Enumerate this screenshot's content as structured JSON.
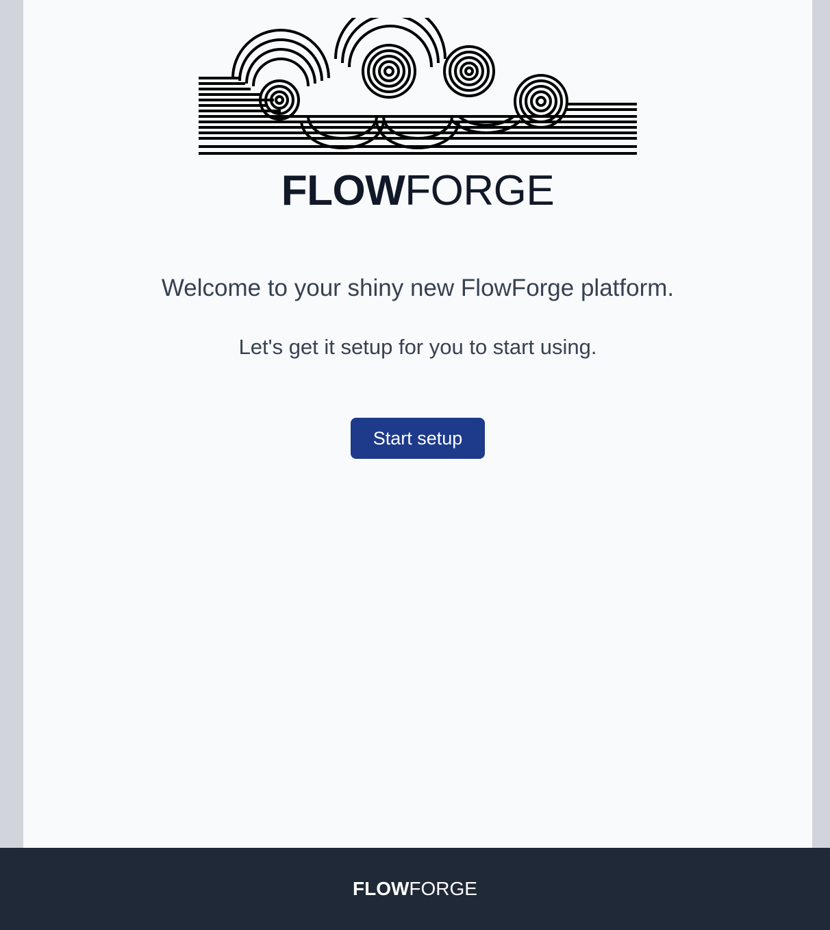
{
  "brand": {
    "word_bold": "FLOW",
    "word_light": "FORGE"
  },
  "welcome": {
    "headline": "Welcome to your shiny new FlowForge platform.",
    "subtext": "Let's get it setup for you to start using."
  },
  "actions": {
    "start_label": "Start setup"
  },
  "footer": {
    "word_bold": "FLOW",
    "word_light": "FORGE"
  },
  "colors": {
    "page_bg": "#f8fafc",
    "side_bg": "#d1d5db",
    "button_bg": "#1e3a8a",
    "footer_bg": "#1f2937"
  },
  "icons": {
    "logo": "flowforge-cloud-logo-icon"
  }
}
